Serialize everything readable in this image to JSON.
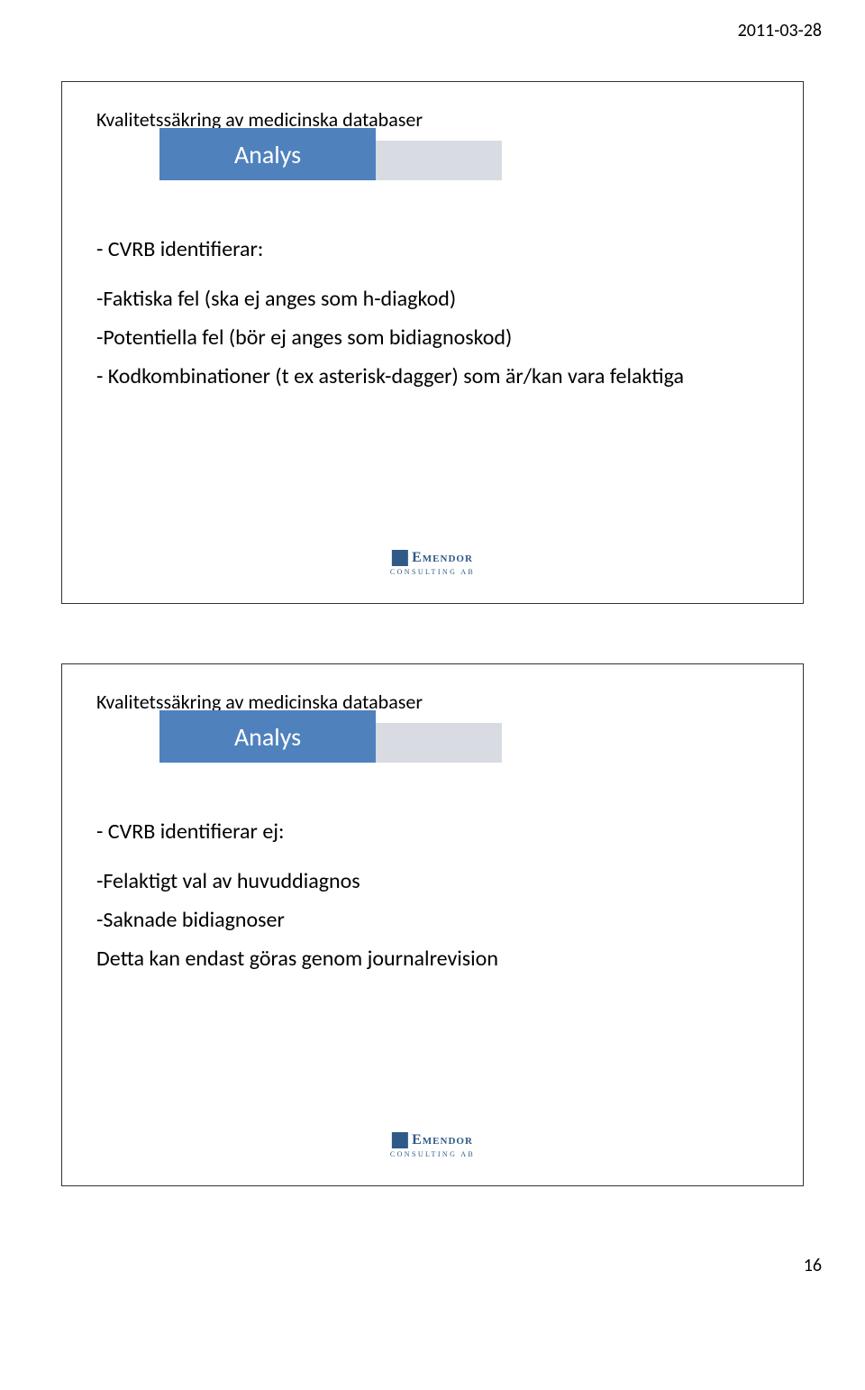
{
  "header": {
    "date": "2011-03-28"
  },
  "footer": {
    "page_number": "16"
  },
  "logo": {
    "name": "Emendor",
    "sub": "CONSULTING AB"
  },
  "slides": [
    {
      "title": "Kvalitetssäkring av medicinska databaser",
      "banner": "Analys",
      "lines": [
        "- CVRB identifierar:",
        "-Faktiska fel (ska ej anges som h-diagkod)",
        "-Potentiella fel (bör ej anges som bidiagnoskod)",
        "- Kodkombinationer (t ex asterisk-dagger) som är/kan vara felaktiga"
      ]
    },
    {
      "title": "Kvalitetssäkring av medicinska databaser",
      "banner": "Analys",
      "lines": [
        "- CVRB identifierar ej:",
        "-Felaktigt val av huvuddiagnos",
        "-Saknade bidiagnoser",
        "Detta kan endast göras genom journalrevision"
      ]
    }
  ]
}
